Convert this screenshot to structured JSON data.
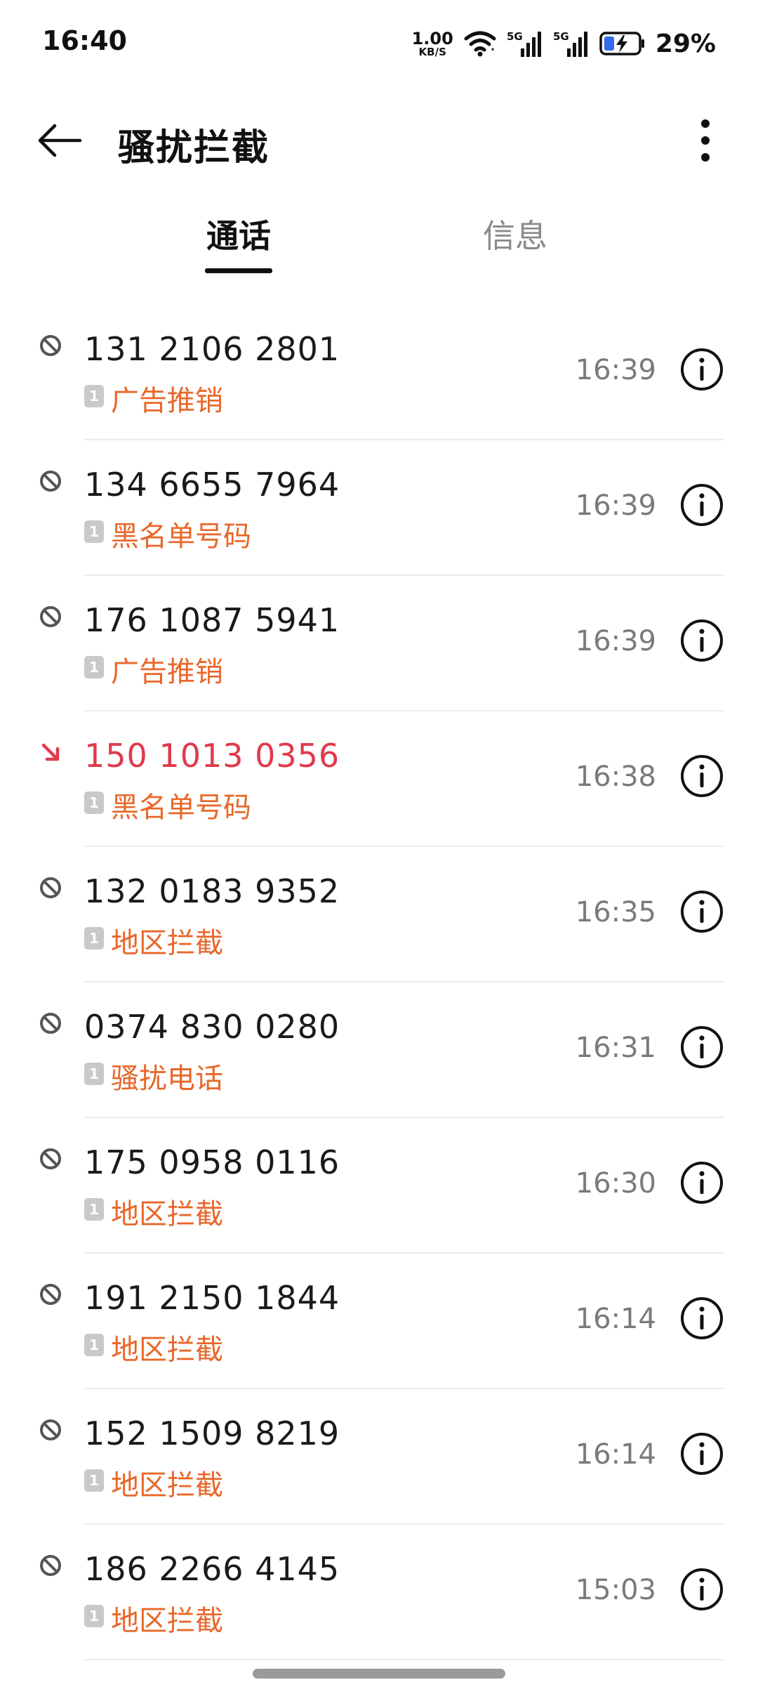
{
  "status_bar": {
    "time": "16:40",
    "net_speed_value": "1.00",
    "net_speed_unit": "KB/S",
    "network_1": "5G",
    "network_2": "5G",
    "battery_percent": "29%"
  },
  "header": {
    "title": "骚扰拦截",
    "back_icon": "arrow-left-icon",
    "more_icon": "more-vertical-icon"
  },
  "tabs": [
    {
      "label": "通话",
      "active": true
    },
    {
      "label": "信息",
      "active": false
    }
  ],
  "colors": {
    "tag": "#e8672a",
    "missed": "#e03a4c",
    "time": "#7a7a7a"
  },
  "calls": [
    {
      "number": "131 2106 2801",
      "tag": "广告推销",
      "time": "16:39",
      "sim": "1",
      "status": "blocked"
    },
    {
      "number": "134 6655 7964",
      "tag": "黑名单号码",
      "time": "16:39",
      "sim": "1",
      "status": "blocked"
    },
    {
      "number": "176 1087 5941",
      "tag": "广告推销",
      "time": "16:39",
      "sim": "1",
      "status": "blocked"
    },
    {
      "number": "150 1013 0356",
      "tag": "黑名单号码",
      "time": "16:38",
      "sim": "1",
      "status": "missed"
    },
    {
      "number": "132 0183 9352",
      "tag": "地区拦截",
      "time": "16:35",
      "sim": "1",
      "status": "blocked"
    },
    {
      "number": "0374 830 0280",
      "tag": "骚扰电话",
      "time": "16:31",
      "sim": "1",
      "status": "blocked"
    },
    {
      "number": "175 0958 0116",
      "tag": "地区拦截",
      "time": "16:30",
      "sim": "1",
      "status": "blocked"
    },
    {
      "number": "191 2150 1844",
      "tag": "地区拦截",
      "time": "16:14",
      "sim": "1",
      "status": "blocked"
    },
    {
      "number": "152 1509 8219",
      "tag": "地区拦截",
      "time": "16:14",
      "sim": "1",
      "status": "blocked"
    },
    {
      "number": "186 2266 4145",
      "tag": "地区拦截",
      "time": "15:03",
      "sim": "1",
      "status": "blocked"
    }
  ]
}
